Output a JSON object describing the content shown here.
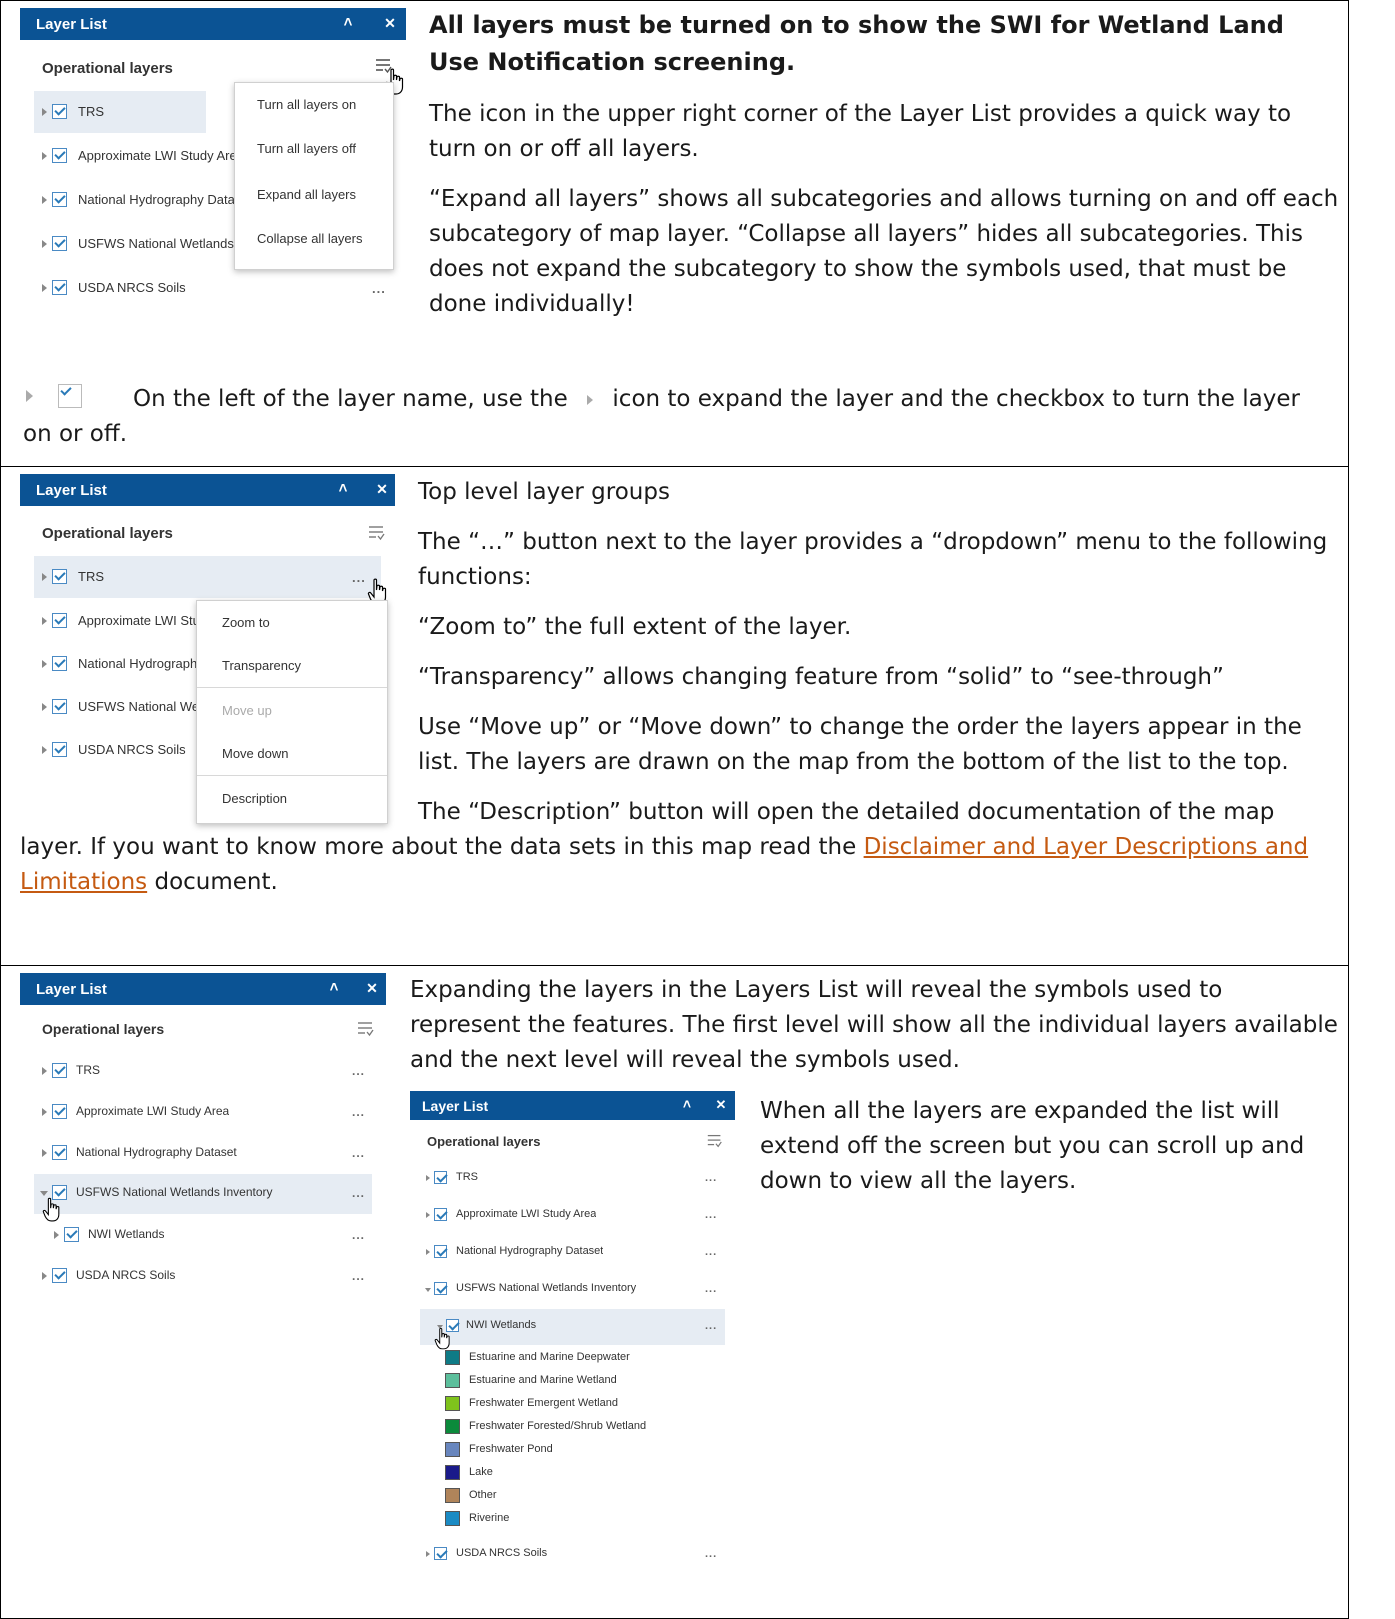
{
  "panel_common": {
    "title": "Layer List",
    "collapse_glyph": "≈",
    "close_glyph": "✕",
    "operational_layers": "Operational layers",
    "dots": "..."
  },
  "section1": {
    "layers": [
      "TRS",
      "Approximate LWI Study Area",
      "National Hydrography Dataset",
      "USFWS National Wetlands Inventory",
      "USDA NRCS Soils"
    ],
    "menu": [
      "Turn all layers on",
      "Turn all layers off",
      "Expand all layers",
      "Collapse all layers"
    ],
    "heading": "All layers must be turned on to show the SWI for Wetland Land Use Notification screening.",
    "para1": "The icon in the upper right corner of the Layer List provides a quick way to turn on or off all layers.",
    "para2": "“Expand all layers” shows all subcategories and allows turning on and off each subcategory of map layer. “Collapse all layers” hides all subcategories. This does not expand the subcategory to show the symbols used, that must be done individually!",
    "para3_a": "On the left of the layer name, use the",
    "para3_b": "icon to expand the layer and the checkbox to turn the layer on or off."
  },
  "section2": {
    "layers": [
      "TRS",
      "Approximate LWI Study Area",
      "National Hydrography Dataset",
      "USFWS National Wetlands Inventory",
      "USDA NRCS Soils"
    ],
    "menu": [
      "Zoom to",
      "Transparency",
      "Move up",
      "Move down",
      "Description"
    ],
    "heading": "Top level layer groups",
    "para1": "The “…” button next to the layer provides a “dropdown” menu to the following functions:",
    "para2": "“Zoom to” the full extent of the layer.",
    "para3": "“Transparency” allows changing feature from “solid” to “see-through”",
    "para4": "Use “Move up” or “Move down” to change the order the layers appear in the list. The layers are drawn on the map from the bottom of the list to the top.",
    "para5_a": "The “Description” button will open the detailed documentation of the map",
    "para5_b": "layer. If you want to know more about the data sets in this map read the",
    "link_1": "Disclaimer and Layer Descriptions and",
    "link_2": "Limitations",
    "para5_c": "document."
  },
  "section3": {
    "layers": [
      "TRS",
      "Approximate LWI Study Area",
      "National Hydrography Dataset",
      "USFWS National Wetlands Inventory",
      "NWI Wetlands",
      "USDA NRCS Soils"
    ],
    "para1": "Expanding the layers in the Layers List will reveal the symbols used to represent the features. The first level will show all the individual layers available and the next level will reveal the symbols used.",
    "para2": "When all the layers are expanded the list will extend off the screen but you can scroll up and down to view all the layers.",
    "inner_layers": [
      "TRS",
      "Approximate LWI Study Area",
      "National Hydrography Dataset",
      "USFWS National Wetlands Inventory",
      "NWI Wetlands",
      "USDA NRCS Soils"
    ],
    "legend": [
      {
        "label": "Estuarine and Marine Deepwater",
        "color": "#0f7b86"
      },
      {
        "label": "Estuarine and Marine Wetland",
        "color": "#5cbf9c"
      },
      {
        "label": "Freshwater Emergent Wetland",
        "color": "#7fc31c"
      },
      {
        "label": "Freshwater Forested/Shrub Wetland",
        "color": "#0b8a3b"
      },
      {
        "label": "Freshwater Pond",
        "color": "#6886be"
      },
      {
        "label": "Lake",
        "color": "#1a1a8a"
      },
      {
        "label": "Other",
        "color": "#b0845a"
      },
      {
        "label": "Riverine",
        "color": "#1b8bc4"
      }
    ]
  }
}
